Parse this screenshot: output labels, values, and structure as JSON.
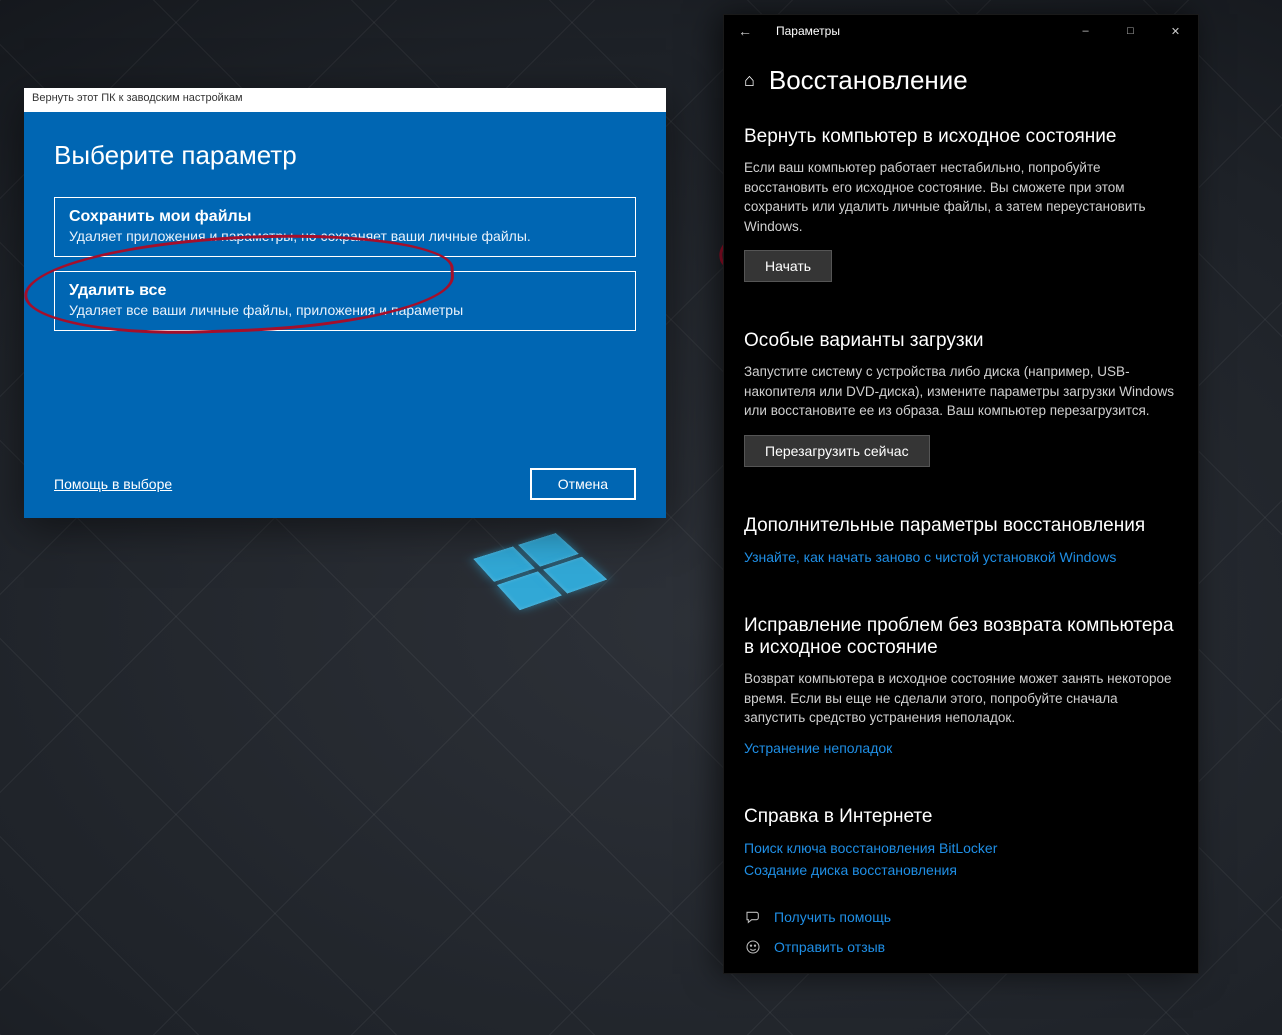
{
  "dialog": {
    "title": "Вернуть этот ПК к заводским настройкам",
    "heading": "Выберите параметр",
    "options": [
      {
        "title": "Сохранить мои файлы",
        "desc": "Удаляет приложения и параметры, но сохраняет ваши личные файлы."
      },
      {
        "title": "Удалить все",
        "desc": "Удаляет все ваши личные файлы, приложения и параметры"
      }
    ],
    "help_link": "Помощь в выборе",
    "cancel": "Отмена"
  },
  "settings": {
    "window_title": "Параметры",
    "page_title": "Восстановление",
    "reset": {
      "title": "Вернуть компьютер в исходное состояние",
      "desc": "Если ваш компьютер работает нестабильно, попробуйте восстановить его исходное состояние. Вы сможете при этом сохранить или удалить личные файлы, а затем переустановить Windows.",
      "button": "Начать"
    },
    "advanced_startup": {
      "title": "Особые варианты загрузки",
      "desc": "Запустите систему с устройства либо диска (например, USB-накопителя или DVD-диска), измените параметры загрузки Windows или восстановите ее из образа. Ваш компьютер перезагрузится.",
      "button": "Перезагрузить сейчас"
    },
    "more_options": {
      "title": "Дополнительные параметры восстановления",
      "link": "Узнайте, как начать заново с чистой установкой Windows"
    },
    "troubleshoot": {
      "title": "Исправление проблем без возврата компьютера в исходное состояние",
      "desc": "Возврат компьютера в исходное состояние может занять некоторое время. Если вы еще не сделали этого, попробуйте сначала запустить средство устранения неполадок.",
      "link": "Устранение неполадок"
    },
    "web_help": {
      "title": "Справка в Интернете",
      "links": [
        "Поиск ключа восстановления BitLocker",
        "Создание диска восстановления"
      ]
    },
    "footer": {
      "get_help": "Получить помощь",
      "feedback": "Отправить отзыв"
    }
  }
}
